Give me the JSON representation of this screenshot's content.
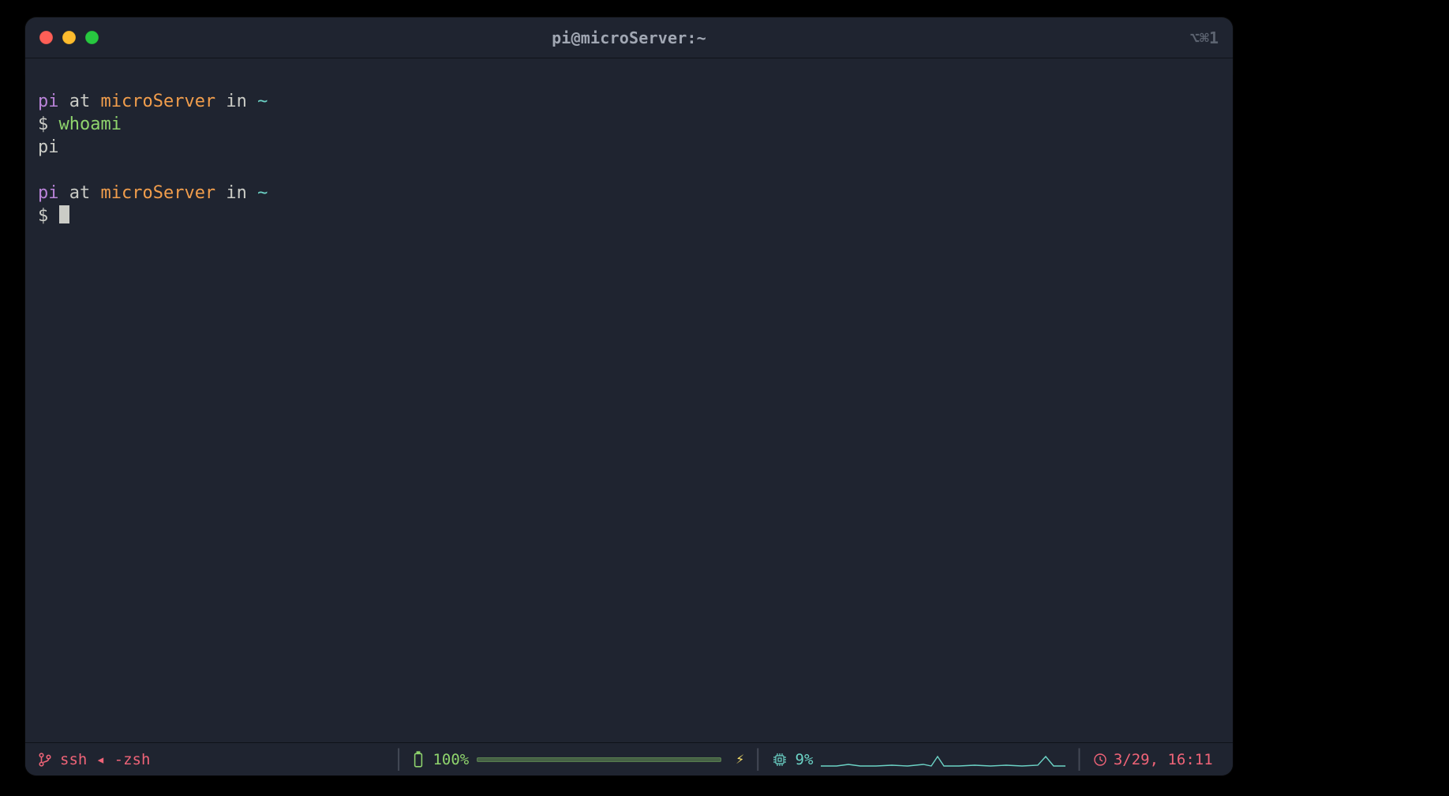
{
  "window": {
    "title": "pi@microServer:~",
    "shortcut": "⌥⌘1"
  },
  "prompt1": {
    "user": "pi",
    "at": " at ",
    "host": "microServer",
    "in": " in ",
    "dir": "~",
    "symbol": "$ ",
    "command": "whoami",
    "output": "pi"
  },
  "prompt2": {
    "user": "pi",
    "at": " at ",
    "host": "microServer",
    "in": " in ",
    "dir": "~",
    "symbol": "$ "
  },
  "status": {
    "process": "ssh ◂ -zsh",
    "battery_pct": "100%",
    "cpu_pct": "9%",
    "datetime": "3/29, 16:11"
  }
}
